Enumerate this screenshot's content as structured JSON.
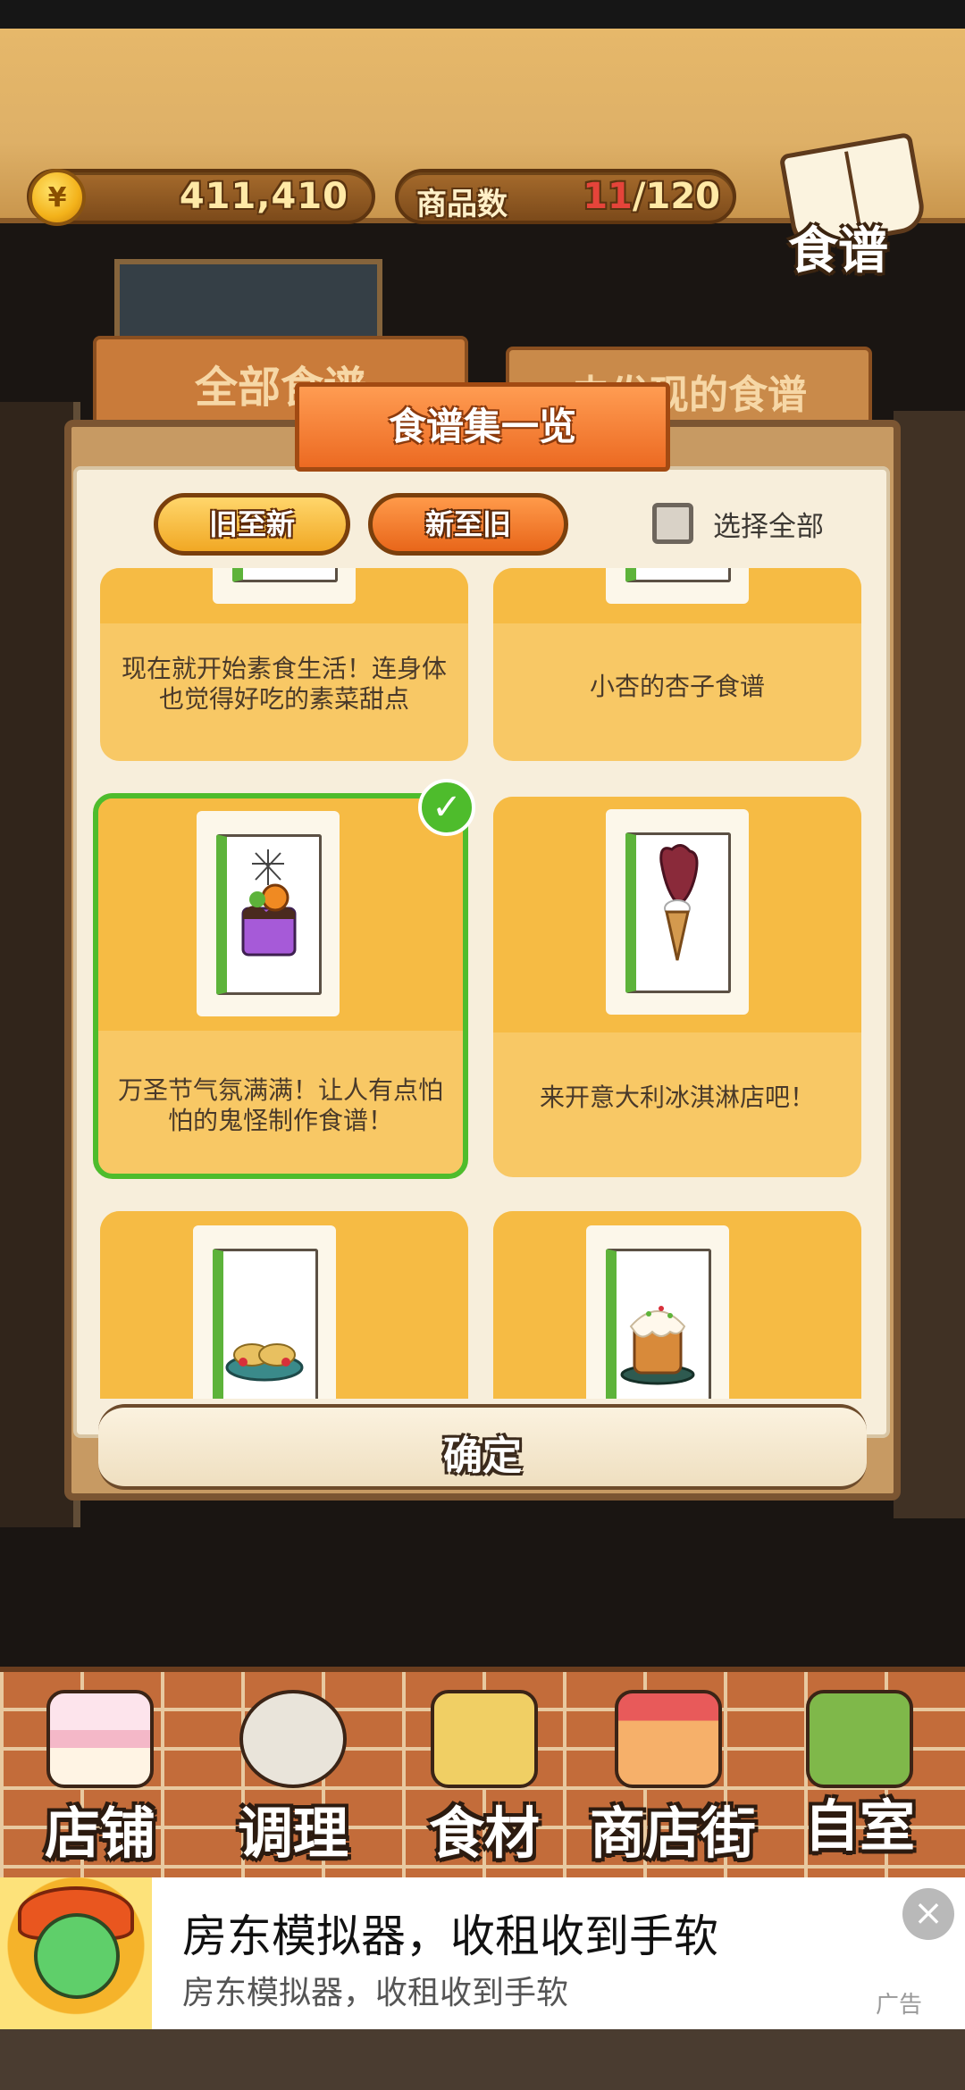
{
  "topbar": {
    "coin_symbol": "¥",
    "coins": "411,410",
    "goods_label": "商品数",
    "goods_current": "11",
    "goods_sep": "/",
    "goods_max": "120",
    "recipe_book_label": "食谱"
  },
  "backdrop": {
    "tab_all": "全部食谱",
    "tab_undiscovered": "未发现的食谱"
  },
  "panel": {
    "title": "食谱集一览",
    "sort_old_to_new": "旧至新",
    "sort_new_to_old": "新至旧",
    "select_all": "选择全部",
    "confirm": "确定"
  },
  "cards": [
    {
      "caption": "现在就开始素食生活！连身体也觉得好吃的素菜甜点",
      "selected": false
    },
    {
      "caption": "小杏的杏子食谱",
      "selected": false
    },
    {
      "caption": "万圣节气氛满满！让人有点怕怕的鬼怪制作食谱！",
      "selected": true,
      "icon": "halloween-cake-icon"
    },
    {
      "caption": "来开意大利冰淇淋店吧！",
      "selected": false,
      "icon": "gelato-cone-icon"
    },
    {
      "caption": "",
      "selected": false,
      "icon": "tart-plate-icon"
    },
    {
      "caption": "",
      "selected": false,
      "icon": "panettone-icon"
    }
  ],
  "navbar": {
    "items": [
      {
        "label": "店铺",
        "icon": "cake-shop-icon"
      },
      {
        "label": "调理",
        "icon": "whisk-bowl-icon"
      },
      {
        "label": "食材",
        "icon": "flour-sack-icon"
      },
      {
        "label": "商店街",
        "icon": "storefront-icon"
      },
      {
        "label": "自室",
        "icon": "staff-only-door-icon"
      }
    ]
  },
  "ad": {
    "title": "房东模拟器，收租收到手软",
    "subtitle": "房东模拟器，收租收到手软",
    "tag": "广告",
    "close": "×"
  },
  "colors": {
    "accent_orange": "#ec6a22",
    "card_yellow": "#f8c865",
    "selected_green": "#4ebc2c",
    "panel_bg": "#f7eedb"
  }
}
